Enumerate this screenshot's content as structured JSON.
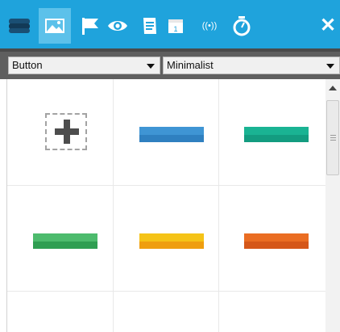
{
  "toolbar": {
    "color": "#1fa3dc",
    "active_color": "#5cc1ea",
    "icons": [
      {
        "name": "layers-icon",
        "active": false
      },
      {
        "name": "image-icon",
        "active": true
      },
      {
        "name": "flag-icon",
        "active": false
      },
      {
        "name": "eye-icon",
        "active": false
      },
      {
        "name": "note-icon",
        "active": false
      },
      {
        "name": "calendar-icon",
        "active": false,
        "text": "1"
      },
      {
        "name": "broadcast-icon",
        "active": false,
        "text": "((•))"
      },
      {
        "name": "timer-icon",
        "active": false
      }
    ],
    "close_label": "✕"
  },
  "selects": {
    "type": {
      "value": "Button"
    },
    "style": {
      "value": "Minimalist"
    }
  },
  "grid": {
    "tiles": [
      {
        "kind": "add",
        "label": "+"
      },
      {
        "kind": "button",
        "colors": {
          "top": "#3f95d4",
          "bottom": "#2f80c0"
        }
      },
      {
        "kind": "button",
        "colors": {
          "top": "#1ab393",
          "bottom": "#139c80"
        }
      },
      {
        "kind": "button",
        "colors": {
          "top": "#4dbb6d",
          "bottom": "#2f9e52"
        }
      },
      {
        "kind": "button",
        "colors": {
          "top": "#f5c317",
          "bottom": "#ef9e0f"
        }
      },
      {
        "kind": "button",
        "colors": {
          "top": "#ea6d22",
          "bottom": "#d55719"
        }
      }
    ]
  }
}
